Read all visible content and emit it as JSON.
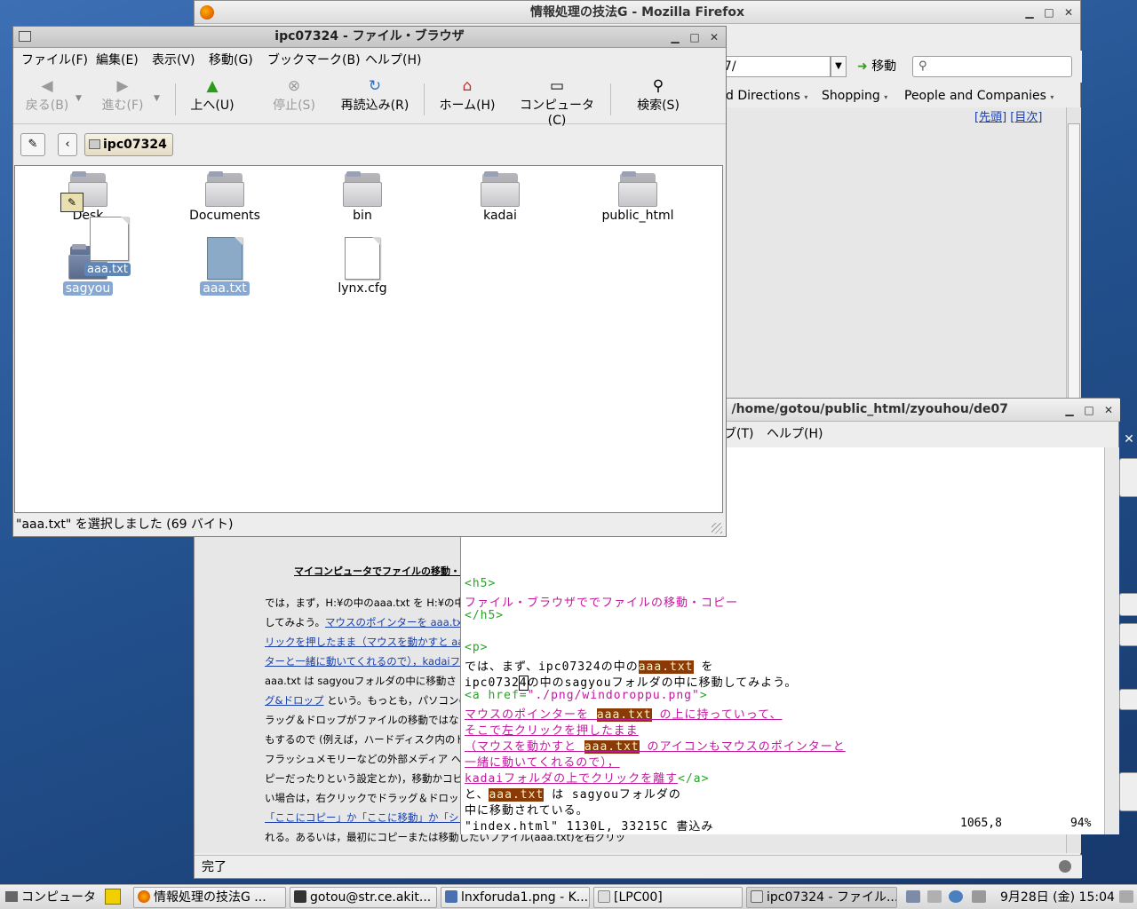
{
  "firefox": {
    "title": "情報処理の技法G - Mozilla Firefox",
    "url_partial": "07/",
    "go_label": "移動",
    "bookmarks": [
      "d Directions",
      "Shopping",
      "People and Companies"
    ],
    "nav_links": [
      "[先頭]",
      "[目次]"
    ],
    "page_heading": "マイコンピュータでファイルの移動・コピ",
    "page_lines": [
      {
        "text": "では，まず，H:¥の中のaaa.txt を H:¥の中",
        "link": ""
      },
      {
        "text": "してみよう。",
        "link": "マウスのポインターを aaa.txt"
      },
      {
        "text": "",
        "link": "リックを押したまま（マウスを動かすと aaa"
      },
      {
        "text": "",
        "link": "ターと一緒に動いてくれるので），kadaiフ"
      },
      {
        "text": "aaa.txt は sagyouフォルダの中に移動さ",
        "link": ""
      },
      {
        "text": " という。もっとも，パソコンの設",
        "link": "グ&ドロップ"
      },
      {
        "text": "ラッグ＆ドロップがファイルの移動ではなく",
        "link": ""
      },
      {
        "text": "もするので (例えば，ハードディスク内のド",
        "link": ""
      },
      {
        "text": "フラッシュメモリーなどの外部メディア への",
        "link": ""
      },
      {
        "text": "ピーだったりという設定とか)，移動かコピ",
        "link": ""
      },
      {
        "text": "い場合は，右クリックでドラッグ＆ドロップす",
        "link": ""
      },
      {
        "text": "",
        "link": "「ここにコピー」か「ここに移動」か「ショー"
      },
      {
        "text": "れる。あるいは，最初にコピーまたは移動したいファイル(aaa.txt)を右クリッ",
        "link": ""
      }
    ],
    "status": "完了"
  },
  "terminal": {
    "title": ": /home/gotou/public_html/zyouhou/de07",
    "menu": [
      "ブ(T)",
      "ヘルプ(H)"
    ],
    "vim_status": "\"index.html\" 1130L, 33215C 書込み",
    "vim_pos": "1065,8",
    "vim_percent": "94%"
  },
  "vim_lines": {
    "l1": "<h5>",
    "l2": "ファイル・ブラウザででファイルの移動・コピー",
    "l3": "</h5>",
    "l4": "<p>",
    "l5a": "では、まず、ipc07324の中の",
    "hl": "aaa.txt",
    "l5b": " を",
    "l6a": "ipc0732",
    "l6cur": "4",
    "l6b": "の中のsagyouフォルダの中に移動してみよう。",
    "l7a": "<a href=",
    "l7b": "\"./png/windoroppu.png\"",
    "l7c": ">",
    "l8a": "マウスのポインターを ",
    "l8b": " の上に持っていって、",
    "l9": "そこで左クリックを押したまま",
    "l10a": "（マウスを動かすと ",
    "l10b": " のアイコンもマウスのポインターと",
    "l11": "一緒に動いてくれるので），",
    "l12a": "kadaiフォルダの上でクリックを離す",
    "l12b": "</a>",
    "l13a": "と、",
    "l13b": " は sagyouフォルダの",
    "l14": "中に移動されている。"
  },
  "filebrowser": {
    "title": "ipc07324 - ファイル・ブラウザ",
    "menu": [
      "ファイル(F)",
      "編集(E)",
      "表示(V)",
      "移動(G)",
      "ブックマーク(B)",
      "ヘルプ(H)"
    ],
    "toolbar": {
      "back": "戻る(B)",
      "forward": "進む(F)",
      "up": "上へ(U)",
      "stop": "停止(S)",
      "reload": "再読込み(R)",
      "home": "ホーム(H)",
      "computer": "コンピュータ(C)",
      "search": "検索(S)"
    },
    "location": "ipc07324",
    "items": {
      "desktop": "Desk",
      "documents": "Documents",
      "bin": "bin",
      "kadai": "kadai",
      "public_html": "public_html",
      "sagyou": "sagyou",
      "aaa": "aaa.txt",
      "lynx": "lynx.cfg"
    },
    "drag_label": "aaa.txt",
    "status": "\"aaa.txt\" を選択しました (69 バイト)"
  },
  "taskbar": {
    "computer": "コンピュータ",
    "tasks": [
      "情報処理の技法G ...",
      "gotou@str.ce.akit...",
      "lnxforuda1.png - K...",
      "[LPC00]",
      "ipc07324 - ファイル..."
    ],
    "clock": "9月28日 (金) 15:04"
  }
}
